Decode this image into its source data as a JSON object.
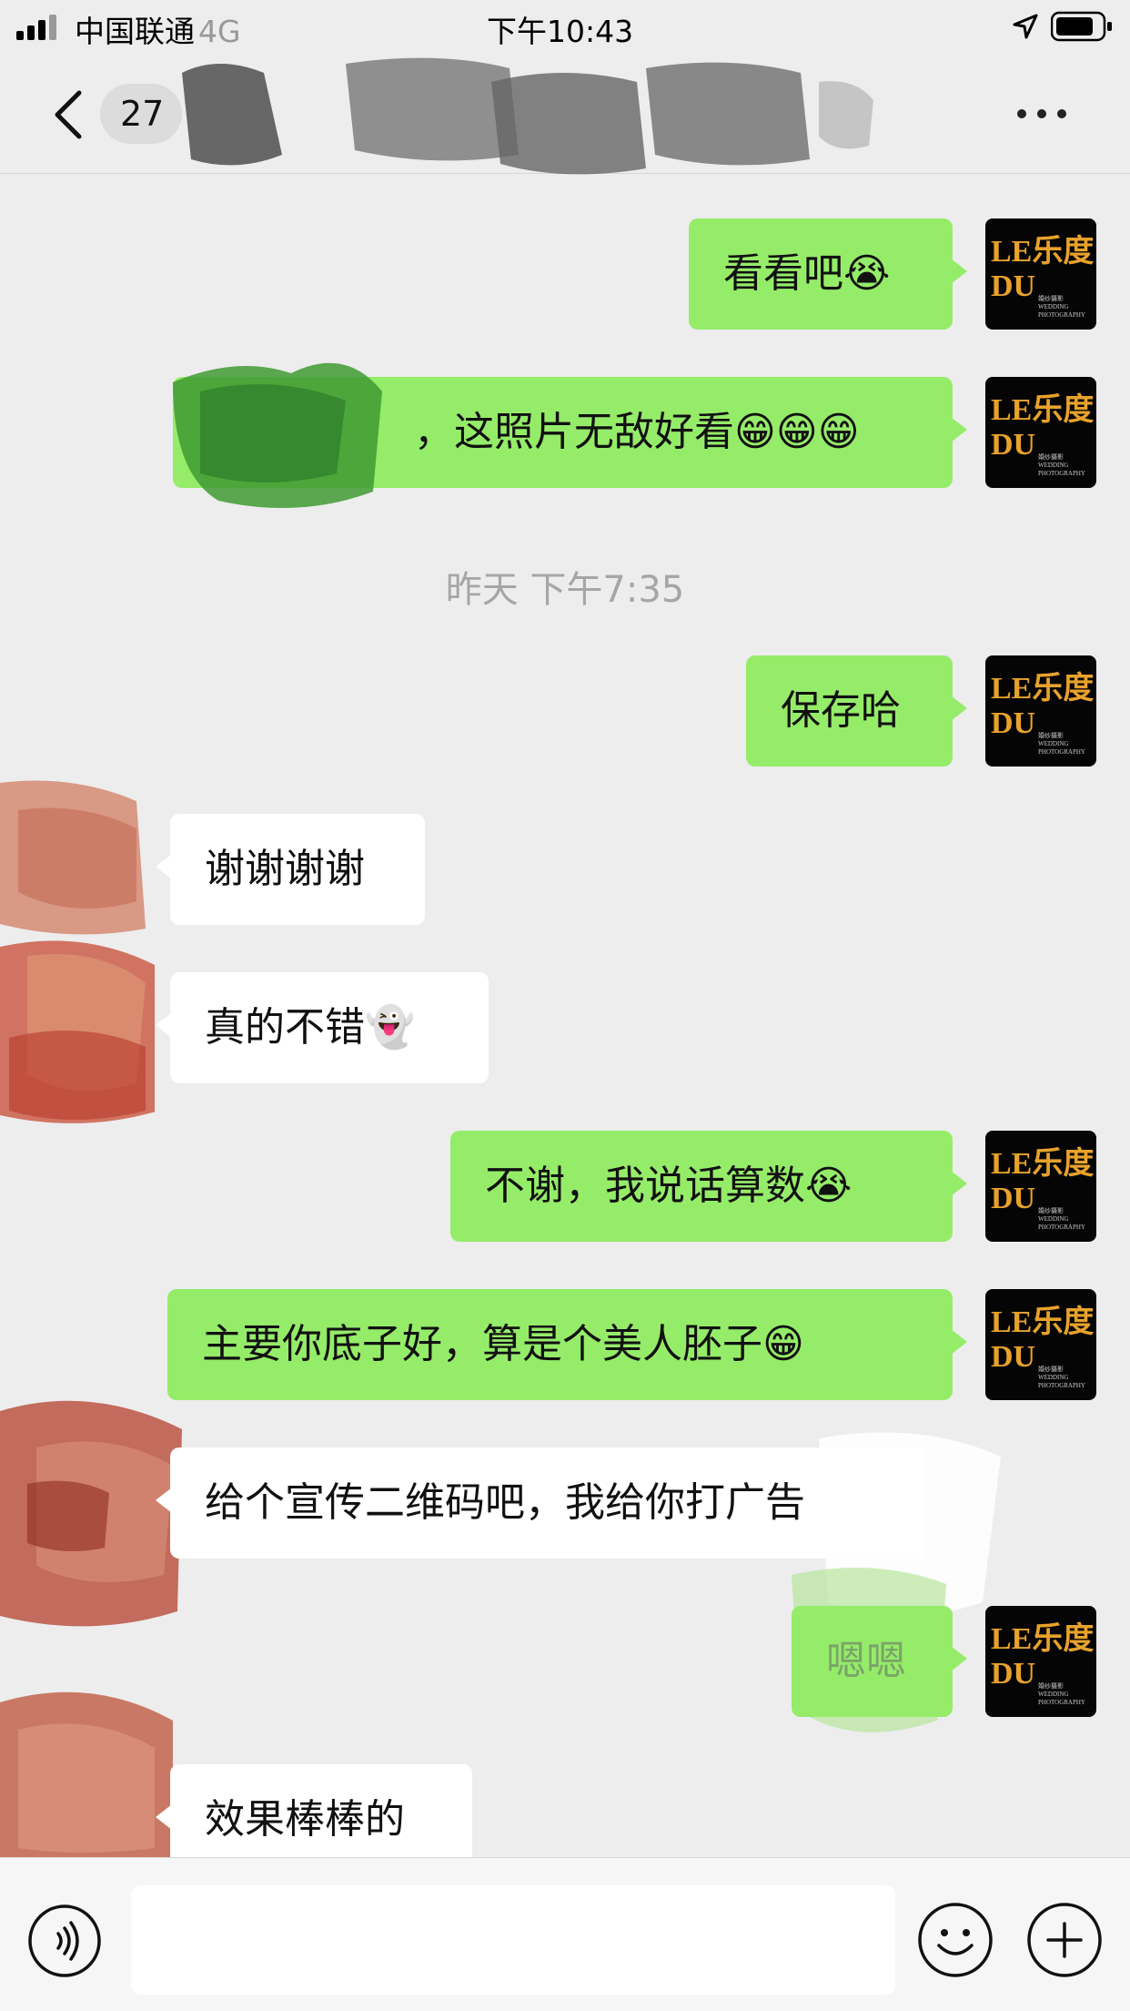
{
  "status_bar": {
    "carrier": "中国联通",
    "network": "4G",
    "time": "下午10:43"
  },
  "nav": {
    "unread_count": "27",
    "contact_name": ""
  },
  "messages": [
    {
      "side": "out",
      "text": "看看吧",
      "emoji": "😭"
    },
    {
      "side": "out",
      "text": "，这照片无敌好看",
      "emoji": "😁😁😁"
    },
    {
      "side": "out",
      "text": "保存哈",
      "emoji": ""
    },
    {
      "side": "in",
      "text": "谢谢谢谢",
      "emoji": ""
    },
    {
      "side": "in",
      "text": "真的不错",
      "emoji": "👻"
    },
    {
      "side": "out",
      "text": "不谢，我说话算数",
      "emoji": "😭"
    },
    {
      "side": "out",
      "text": "主要你底子好，算是个美人胚子",
      "emoji": "😁"
    },
    {
      "side": "in",
      "text": "给个宣传二维码吧，我给你打广告",
      "emoji": ""
    },
    {
      "side": "out",
      "text": "嗯嗯",
      "emoji": ""
    },
    {
      "side": "in",
      "text": "效果棒棒的",
      "emoji": ""
    }
  ],
  "timestamp": "昨天 下午7:35",
  "avatar_logo": {
    "line1": "LE乐度",
    "line2": "DU",
    "sub1": "婚纱摄影",
    "sub2": "WEDDING",
    "sub3": "PHOTOGRAPHY"
  },
  "input": {
    "placeholder": ""
  },
  "icons": [
    "signal-icon",
    "location-icon",
    "battery-icon",
    "back-icon",
    "more-icon",
    "voice-icon",
    "emoji-icon",
    "plus-icon"
  ],
  "colors": {
    "background": "#ededed",
    "outgoing_bubble": "#95ec69",
    "incoming_bubble": "#ffffff",
    "timestamp_text": "#a6a6a6",
    "avatar_gold": "#e8a22b"
  }
}
